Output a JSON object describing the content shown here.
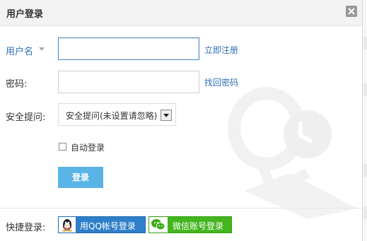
{
  "dialog": {
    "title": "用户登录"
  },
  "form": {
    "username": {
      "label": "用户名",
      "value": "",
      "link": "立即注册"
    },
    "password": {
      "label": "密码:",
      "value": "",
      "link": "找回密码"
    },
    "security": {
      "label": "安全提问:",
      "selected": "安全提问(未设置请忽略)"
    },
    "auto_login": {
      "label": "自动登录",
      "checked": false
    },
    "login_button": "登录"
  },
  "quick_login": {
    "label": "快捷登录:",
    "qq_button": "用QQ帐号登录",
    "wechat_button": "微信账号登录"
  },
  "colors": {
    "link": "#2d6fb7",
    "login_button": "#5bb4e6",
    "qq": "#2e7fc9",
    "wechat": "#43b51e"
  },
  "icons": [
    "close-icon",
    "caret-down-icon",
    "qq-penguin-icon",
    "wechat-icon",
    "qq-watermark-icon"
  ]
}
